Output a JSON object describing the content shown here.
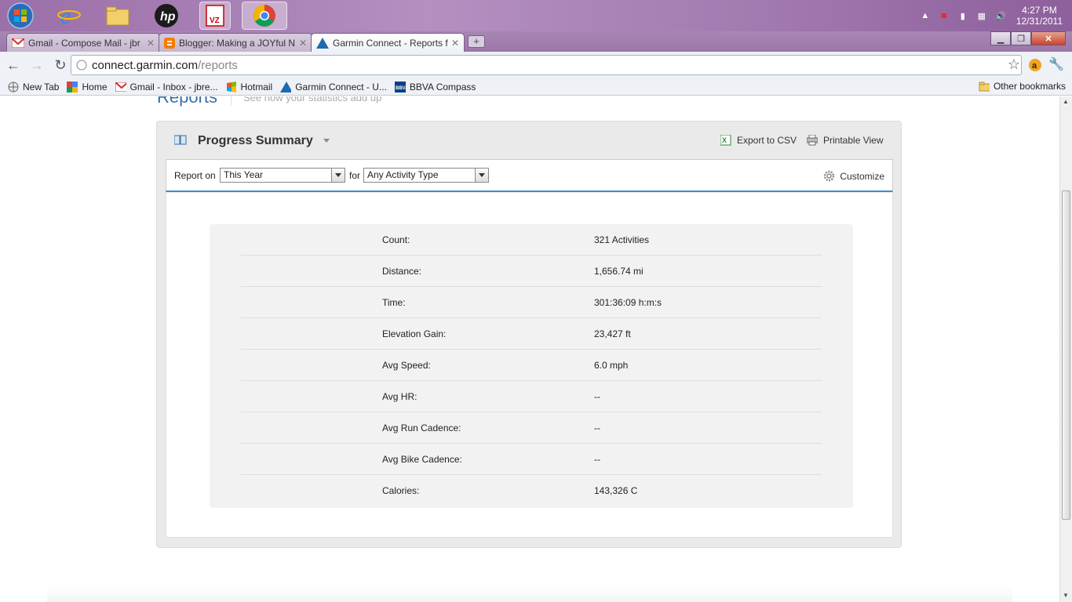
{
  "taskbar": {
    "clock_time": "4:27 PM",
    "clock_date": "12/31/2011"
  },
  "tabs": [
    {
      "title": "Gmail - Compose Mail - jbr",
      "icon": "gmail-icon"
    },
    {
      "title": "Blogger: Making a JOYful N",
      "icon": "blogger-icon"
    },
    {
      "title": "Garmin Connect - Reports f",
      "icon": "garmin-icon",
      "active": true
    }
  ],
  "address": {
    "host": "connect.garmin.com",
    "path": "/reports"
  },
  "bookmarks": [
    {
      "label": "New Tab",
      "icon": "globe-icon"
    },
    {
      "label": "Home",
      "icon": "google-icon"
    },
    {
      "label": "Gmail - Inbox - jbre...",
      "icon": "gmail-icon"
    },
    {
      "label": "Hotmail",
      "icon": "msn-icon"
    },
    {
      "label": "Garmin Connect - U...",
      "icon": "garmin-icon"
    },
    {
      "label": "BBVA Compass",
      "icon": "bbva-icon"
    }
  ],
  "other_bookmarks": "Other bookmarks",
  "page_header": {
    "title": "Reports",
    "subtitle": "See how your statistics add up"
  },
  "panel": {
    "title": "Progress Summary",
    "export_csv": "Export to CSV",
    "printable_view": "Printable View",
    "report_on_label": "Report on",
    "period_value": "This Year",
    "for_label": "for",
    "activity_value": "Any Activity Type",
    "customize": "Customize"
  },
  "stats": [
    {
      "label": "Count:",
      "value": "321 Activities"
    },
    {
      "label": "Distance:",
      "value": "1,656.74 mi"
    },
    {
      "label": "Time:",
      "value": "301:36:09 h:m:s"
    },
    {
      "label": "Elevation Gain:",
      "value": "23,427 ft"
    },
    {
      "label": "Avg Speed:",
      "value": "6.0 mph"
    },
    {
      "label": "Avg HR:",
      "value": "--"
    },
    {
      "label": "Avg Run Cadence:",
      "value": "--"
    },
    {
      "label": "Avg Bike Cadence:",
      "value": "--"
    },
    {
      "label": "Calories:",
      "value": "143,326 C"
    }
  ],
  "colors": {
    "accent_blue": "#3b8fd6",
    "taskbar_purple": "#9b6fa8"
  }
}
